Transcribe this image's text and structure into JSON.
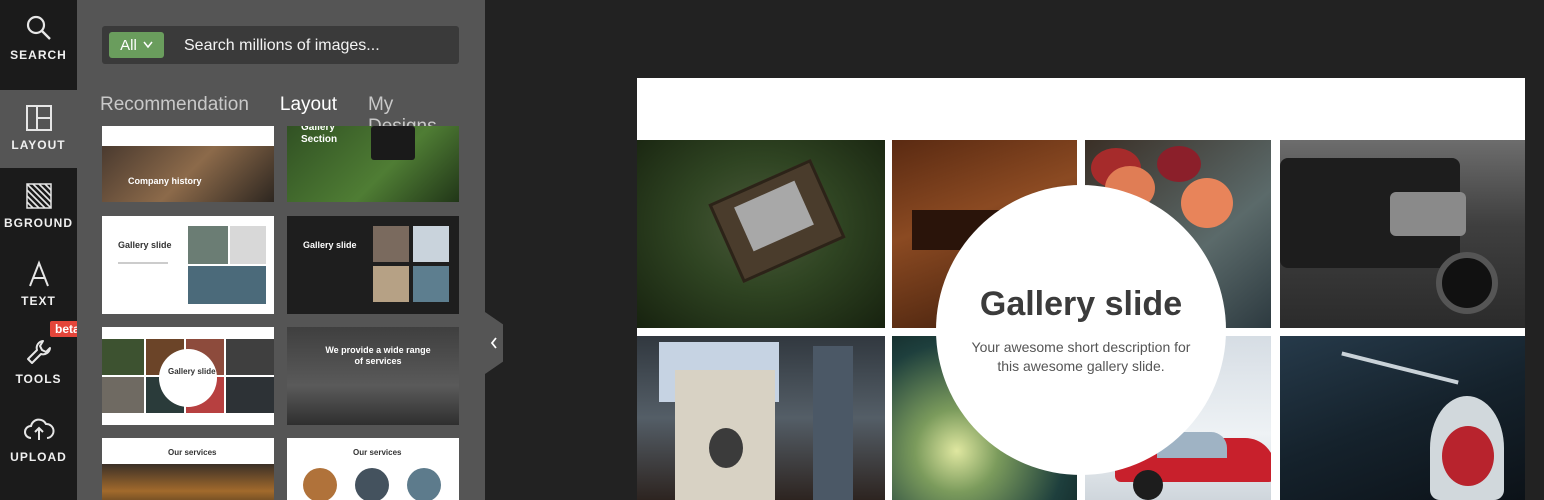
{
  "rail": {
    "items": [
      {
        "label": "SEARCH",
        "icon": "search-icon"
      },
      {
        "label": "LAYOUT",
        "icon": "layout-icon"
      },
      {
        "label": "BGROUND",
        "icon": "background-icon"
      },
      {
        "label": "TEXT",
        "icon": "text-icon"
      },
      {
        "label": "TOOLS",
        "icon": "wrench-icon"
      },
      {
        "label": "UPLOAD",
        "icon": "cloud-upload-icon"
      }
    ],
    "active": "LAYOUT",
    "beta_badge": "beta"
  },
  "search": {
    "filter_label": "All",
    "placeholder": "Search millions of images..."
  },
  "tabs": [
    {
      "label": "Recommendation"
    },
    {
      "label": "Layout"
    },
    {
      "label": "My Designs"
    }
  ],
  "active_tab": "Layout",
  "thumbnails": [
    {
      "title": "Company history"
    },
    {
      "title": "Gallery Section"
    },
    {
      "title": "Gallery slide"
    },
    {
      "title": "Gallery slide"
    },
    {
      "title": "Gallery slide"
    },
    {
      "title": "We provide a wide range of services"
    },
    {
      "title": "Our services"
    },
    {
      "title": "Our services"
    }
  ],
  "slide": {
    "title": "Gallery slide",
    "description": "Your awesome short description for this awesome gallery slide."
  },
  "colors": {
    "accent_green": "#6a9d5d",
    "beta_red": "#e4453a",
    "panel_bg": "#555555",
    "rail_bg": "#1b1b1b",
    "workspace_bg": "#222222"
  }
}
